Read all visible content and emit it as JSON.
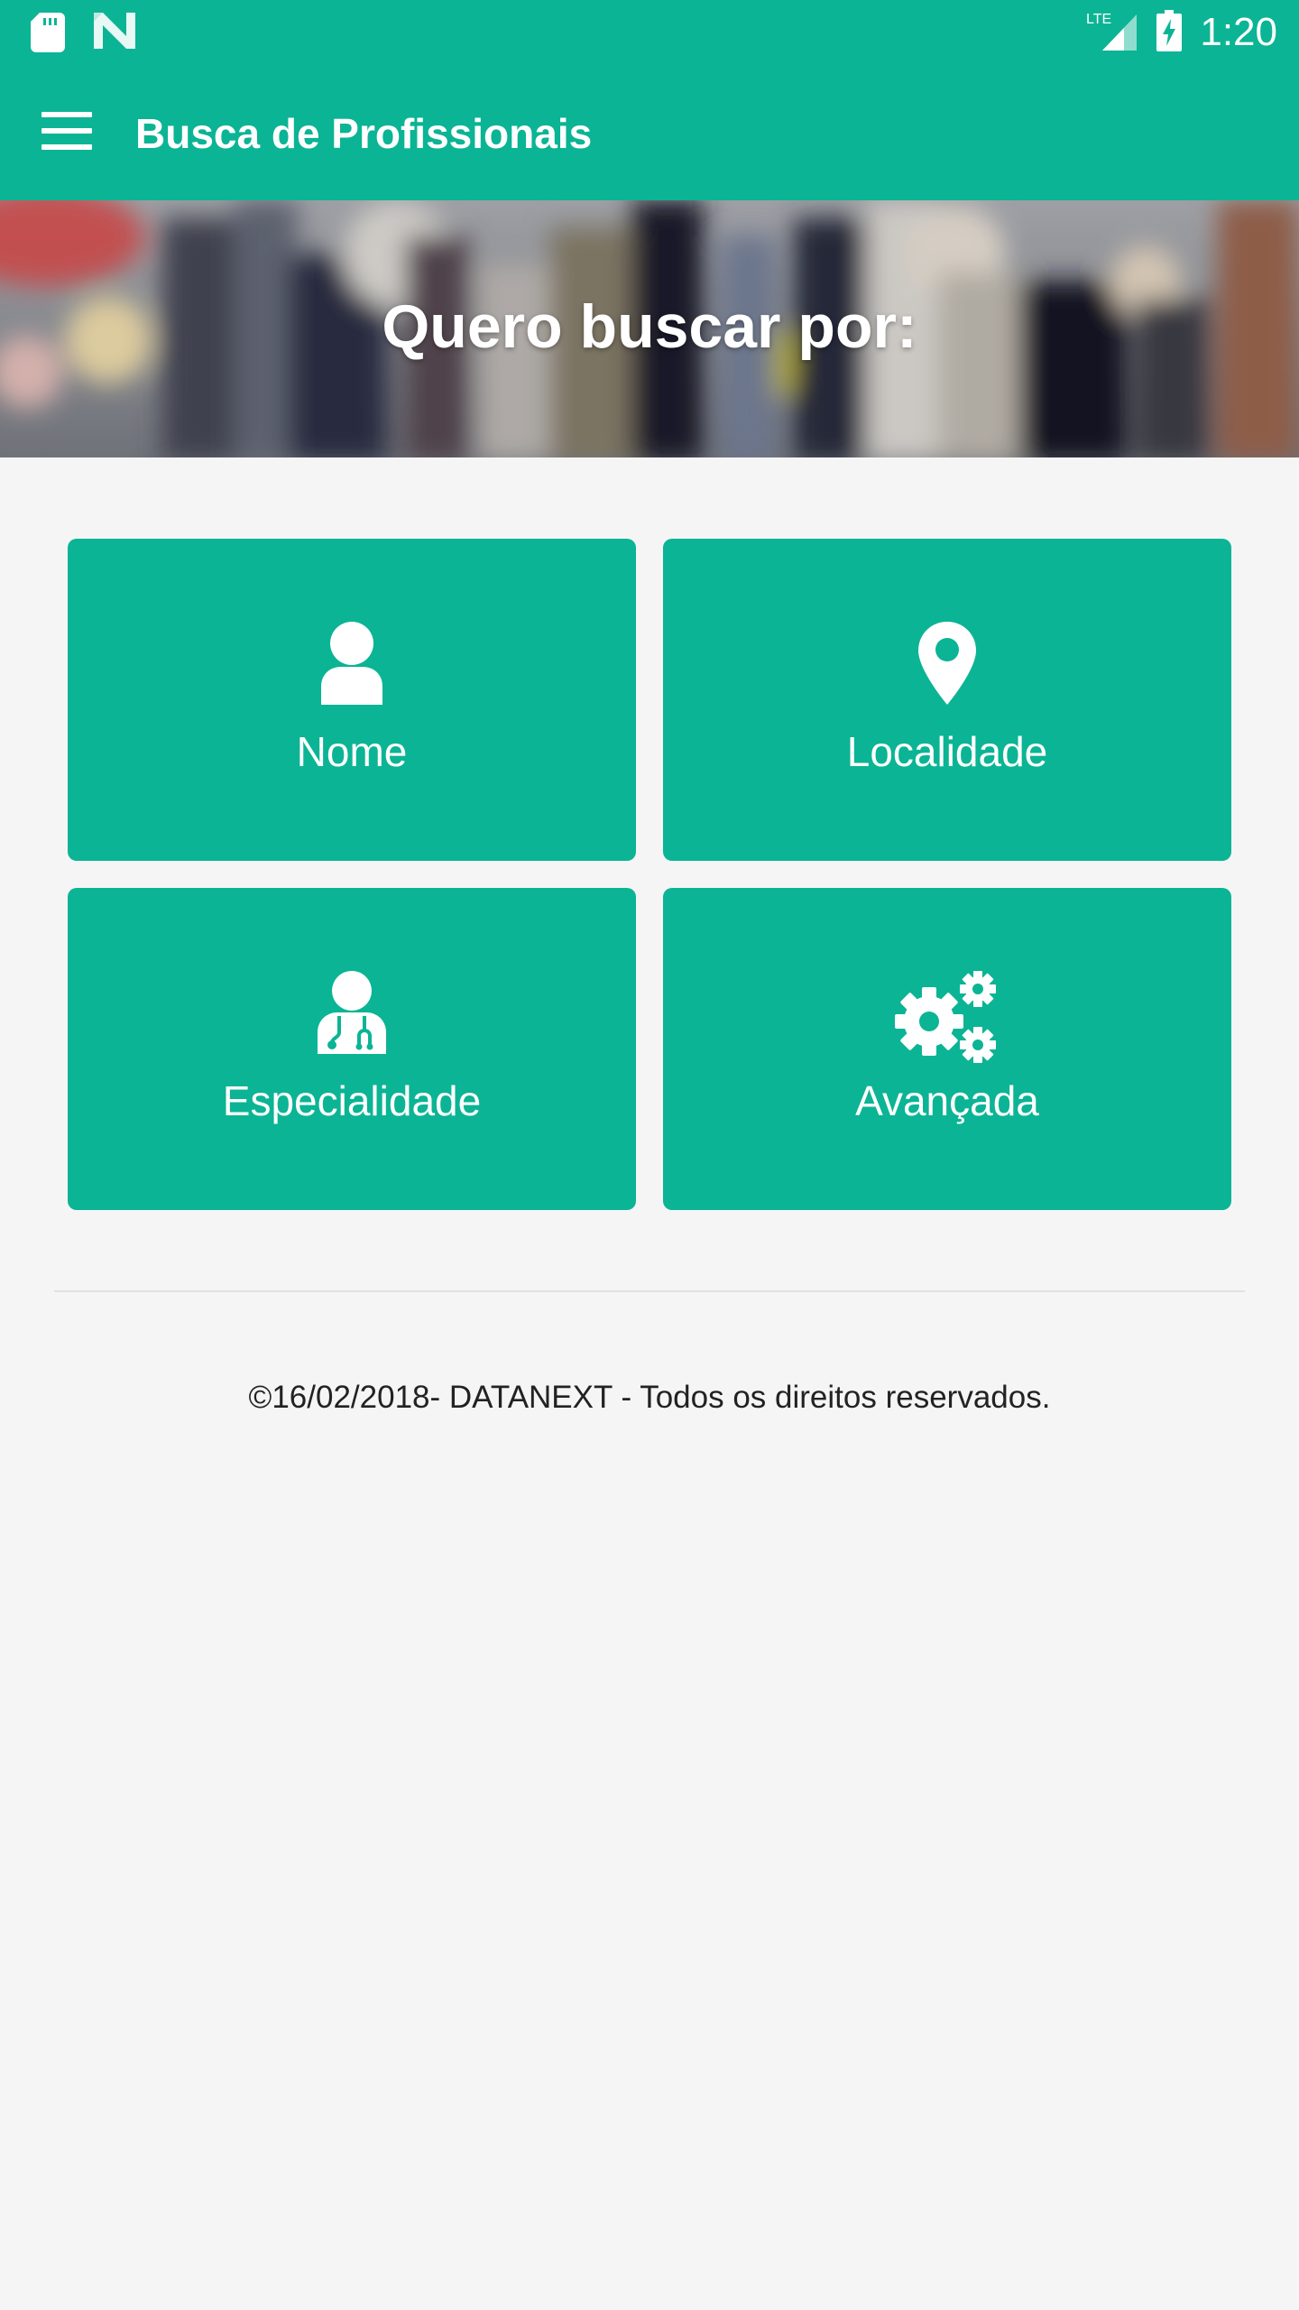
{
  "status_bar": {
    "time": "1:20",
    "network": "LTE",
    "icons": [
      "sd-card-icon",
      "n-logo-icon",
      "signal-icon",
      "battery-charging-icon"
    ]
  },
  "app_bar": {
    "title": "Busca de Profissionais",
    "menu_icon": "hamburger-menu-icon"
  },
  "hero": {
    "title": "Quero buscar por:"
  },
  "tiles": [
    {
      "label": "Nome",
      "icon": "person-icon"
    },
    {
      "label": "Localidade",
      "icon": "map-pin-icon"
    },
    {
      "label": "Especialidade",
      "icon": "doctor-icon"
    },
    {
      "label": "Avançada",
      "icon": "gears-icon"
    }
  ],
  "footer": {
    "text": "©16/02/2018- DATANEXT - Todos os direitos reservados."
  },
  "colors": {
    "primary": "#0bb494",
    "background": "#f5f5f5",
    "text": "#222222"
  }
}
